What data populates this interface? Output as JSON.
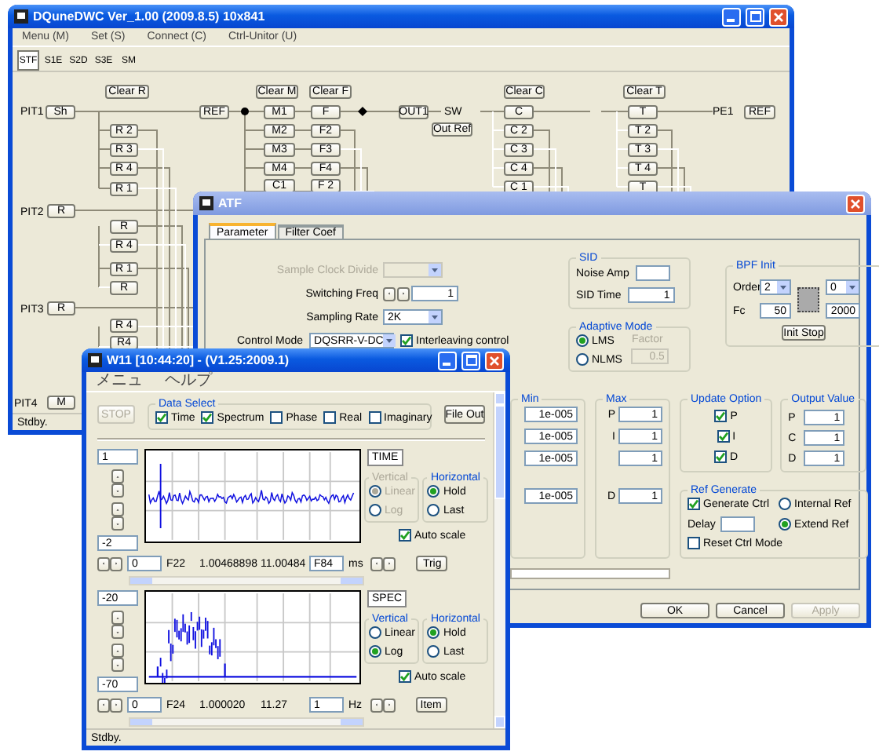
{
  "main_window": {
    "title": "DQuneDWC  Ver_1.00  (2009.8.5) 10x841",
    "menu": [
      "Menu (M)",
      "Set (S)",
      "Connect (C)",
      "Ctrl-Unitor (U)"
    ],
    "toolbar": [
      {
        "label": "STF",
        "selected": true
      },
      {
        "label": "S1E",
        "selected": false
      },
      {
        "label": "S2D",
        "selected": false
      },
      {
        "label": "S3E",
        "selected": false
      },
      {
        "label": "SM",
        "selected": false
      }
    ],
    "nodes": [
      {
        "kind": "button",
        "label": "Clear R"
      },
      {
        "kind": "button",
        "label": "Clear M"
      },
      {
        "kind": "button",
        "label": "Clear F"
      },
      {
        "kind": "button",
        "label": "Clear C"
      },
      {
        "kind": "button",
        "label": "Clear T"
      },
      {
        "kind": "label",
        "label": "PIT1"
      },
      {
        "kind": "button",
        "label": "Sh"
      },
      {
        "kind": "button",
        "label": "REF"
      },
      {
        "kind": "button",
        "label": "M1"
      },
      {
        "kind": "button",
        "label": "M2"
      },
      {
        "kind": "button",
        "label": "M3"
      },
      {
        "kind": "button",
        "label": "M4"
      },
      {
        "kind": "button",
        "label": "C1"
      },
      {
        "kind": "button",
        "label": "F"
      },
      {
        "kind": "button",
        "label": "F2"
      },
      {
        "kind": "button",
        "label": "F3"
      },
      {
        "kind": "button",
        "label": "F4"
      },
      {
        "kind": "button",
        "label": "F 2"
      },
      {
        "kind": "button",
        "label": "OUT1"
      },
      {
        "kind": "label",
        "label": "SW"
      },
      {
        "kind": "button",
        "label": "Out Ref"
      },
      {
        "kind": "button",
        "label": "C"
      },
      {
        "kind": "button",
        "label": "C 2"
      },
      {
        "kind": "button",
        "label": "C 3"
      },
      {
        "kind": "button",
        "label": "C 4"
      },
      {
        "kind": "button",
        "label": "C 1"
      },
      {
        "kind": "button",
        "label": "T"
      },
      {
        "kind": "button",
        "label": "T 2"
      },
      {
        "kind": "button",
        "label": "T 3"
      },
      {
        "kind": "button",
        "label": "T 4"
      },
      {
        "kind": "button",
        "label": "T"
      },
      {
        "kind": "label",
        "label": "PE1"
      },
      {
        "kind": "button",
        "label": "REF"
      },
      {
        "kind": "button",
        "label": "R 2"
      },
      {
        "kind": "button",
        "label": "R 3"
      },
      {
        "kind": "button",
        "label": "R 4"
      },
      {
        "kind": "button",
        "label": "R 1"
      },
      {
        "kind": "label",
        "label": "PIT2"
      },
      {
        "kind": "button",
        "label": "R"
      },
      {
        "kind": "button",
        "label": "R"
      },
      {
        "kind": "button",
        "label": "R 4"
      },
      {
        "kind": "button",
        "label": "R 1"
      },
      {
        "kind": "button",
        "label": "R"
      },
      {
        "kind": "label",
        "label": "PIT3"
      },
      {
        "kind": "button",
        "label": "R"
      },
      {
        "kind": "button",
        "label": "R 4"
      },
      {
        "kind": "button",
        "label": "R4"
      },
      {
        "kind": "label",
        "label": "PIT4"
      },
      {
        "kind": "button",
        "label": "M"
      }
    ],
    "status": "Stdby."
  },
  "dialog": {
    "title": "ATF",
    "tabs": [
      {
        "label": "Parameter",
        "selected": true
      },
      {
        "label": "Filter Coef",
        "selected": false
      }
    ],
    "sample_clock_divide": {
      "label": "Sample Clock Divide",
      "disabled": true
    },
    "switching_freq": {
      "label": "Switching Freq",
      "value": "1"
    },
    "sampling_rate": {
      "label": "Sampling Rate",
      "value": "2K"
    },
    "control_mode": {
      "label": "Control Mode",
      "value": "DQSRR-V-DC"
    },
    "interleaving": {
      "label": "Interleaving control",
      "checked": true
    },
    "sid": {
      "title": "SID",
      "noise_amp": "Noise Amp",
      "sid_time": {
        "label": "SID Time",
        "value": "1"
      }
    },
    "adaptive": {
      "title": "Adaptive Mode",
      "options": [
        {
          "label": "LMS",
          "selected": true
        },
        {
          "label": "NLMS",
          "selected": false
        }
      ],
      "factor": {
        "label": "Factor",
        "value": "0.5",
        "disabled": true
      }
    },
    "bpf": {
      "title": "BPF Init",
      "order": {
        "label": "Order",
        "value": "2"
      },
      "order2": "0",
      "fc": {
        "label": "Fc",
        "value": "50"
      },
      "fc2": "2000",
      "button": "Init Stop"
    },
    "min": {
      "title": "Min",
      "values": [
        "1e-005",
        "1e-005",
        "1e-005",
        "1e-005"
      ]
    },
    "max": {
      "title": "Max",
      "rows": [
        {
          "label": "P",
          "value": "1"
        },
        {
          "label": "I",
          "value": "1"
        },
        {
          "value": "1"
        },
        {
          "label": "D",
          "value": "1"
        }
      ]
    },
    "update_option": {
      "title": "Update Option",
      "rows": [
        {
          "label": "P",
          "checked": true
        },
        {
          "label": "I",
          "checked": true
        },
        {
          "label": "D",
          "checked": true
        }
      ]
    },
    "output_value": {
      "title": "Output Value",
      "rows": [
        {
          "label": "P",
          "value": "1"
        },
        {
          "label": "C",
          "value": "1"
        },
        {
          "label": "D",
          "value": "1"
        }
      ]
    },
    "ref_generate": {
      "title": "Ref Generate",
      "generate": {
        "label": "Generate Ctrl",
        "checked": true
      },
      "modes": [
        {
          "label": "Internal Ref",
          "selected": false
        },
        {
          "label": "Extend Ref",
          "selected": true
        }
      ],
      "delay": "Delay",
      "reset": {
        "label": "Reset Ctrl Mode",
        "checked": false
      }
    },
    "progress": {
      "level": 0
    },
    "buttons": [
      {
        "label": "OK",
        "disabled": false
      },
      {
        "label": "Cancel",
        "disabled": false
      },
      {
        "label": "Apply",
        "disabled": true
      }
    ]
  },
  "plot_window": {
    "title": "W11 [10:44:20] - (V1.25:2009.1)",
    "menu": [
      "メニュ",
      "ヘルプ"
    ],
    "stop": {
      "label": "STOP",
      "disabled": true
    },
    "data_select": {
      "title": "Data Select",
      "items": [
        {
          "label": "Time",
          "checked": true
        },
        {
          "label": "Spectrum",
          "checked": true
        },
        {
          "label": "Phase",
          "checked": false
        },
        {
          "label": "Real",
          "checked": false
        },
        {
          "label": "Imaginary",
          "checked": false
        }
      ]
    },
    "file_out": "File Out",
    "plots": [
      {
        "kind": "time",
        "title": "TIME",
        "ymax": "1",
        "ymin": "-2",
        "xmin": "0",
        "ch": "F22",
        "value1": "1.00468898",
        "value2": "11.00484",
        "ch2": "F84",
        "unit": "ms",
        "button": "Trig",
        "vertical": {
          "title": "Vertical",
          "disabled": true,
          "options": [
            {
              "label": "Linear",
              "selected": true
            },
            {
              "label": "Log",
              "selected": false
            }
          ]
        },
        "horizontal": {
          "title": "Horizontal",
          "options": [
            {
              "label": "Hold",
              "selected": true
            },
            {
              "label": "Last",
              "selected": false
            }
          ]
        },
        "auto_scale": {
          "label": "Auto scale",
          "checked": true
        }
      },
      {
        "kind": "spectrum",
        "title": "SPEC",
        "ymax": "-20",
        "ymin": "-70",
        "xmin": "0",
        "ch": "F24",
        "value1": "1.000020",
        "value2": "11.27",
        "ch2": "1",
        "unit": "Hz",
        "button": "Item",
        "vertical": {
          "title": "Vertical",
          "disabled": false,
          "options": [
            {
              "label": "Linear",
              "selected": false
            },
            {
              "label": "Log",
              "selected": true
            }
          ]
        },
        "horizontal": {
          "title": "Horizontal",
          "options": [
            {
              "label": "Hold",
              "selected": true
            },
            {
              "label": "Last",
              "selected": false
            }
          ]
        },
        "auto_scale": {
          "label": "Auto scale",
          "checked": true
        }
      }
    ],
    "status": "Stdby."
  }
}
